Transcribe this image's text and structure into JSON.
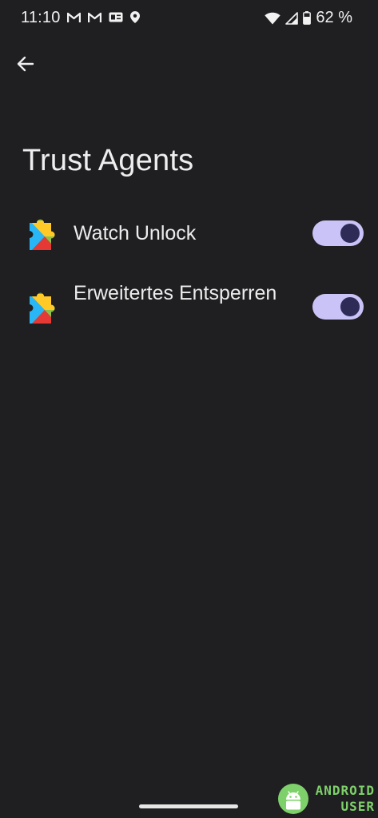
{
  "status_bar": {
    "time": "11:10",
    "notification_icons": [
      "gmail-icon",
      "gmail-icon",
      "news-icon",
      "location-icon"
    ],
    "system_icons": [
      "wifi-icon",
      "cell-signal-icon",
      "battery-icon"
    ],
    "battery_percent": "62 %"
  },
  "header": {
    "back_icon": "arrow-back-icon",
    "title": "Trust Agents"
  },
  "agents": [
    {
      "label": "Watch Unlock",
      "icon": "google-play-services-icon",
      "enabled": true
    },
    {
      "label": "Erweitertes Entsperren",
      "icon": "google-play-services-icon",
      "enabled": true
    }
  ],
  "watermark": {
    "line1": "ANDROID",
    "line2": "USER"
  },
  "colors": {
    "background": "#1f1e21",
    "toggle_track_on": "#c9c3f7",
    "toggle_knob_on": "#2f2b57",
    "watermark_green": "#7ed16a"
  }
}
